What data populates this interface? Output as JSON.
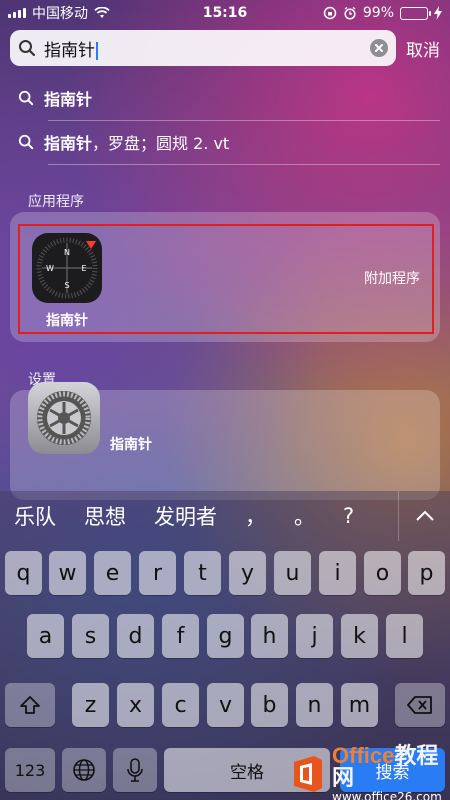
{
  "status_bar": {
    "carrier": "中国移动",
    "time": "15:16",
    "battery": "99%"
  },
  "search": {
    "value": "指南针",
    "cancel_label": "取消"
  },
  "suggestions": [
    {
      "bold": "指南针",
      "rest": ""
    },
    {
      "bold": "指南针",
      "rest": "，罗盘；圆规 2. vt"
    }
  ],
  "sections": {
    "apps_label": "应用程序",
    "settings_label": "设置"
  },
  "app_result": {
    "name": "指南针",
    "extra_label": "附加程序",
    "compass_letters": {
      "n": "N",
      "e": "E",
      "s": "S",
      "w": "W"
    }
  },
  "settings_result": {
    "name": "指南针"
  },
  "keyboard": {
    "candidates": [
      "乐队",
      "思想",
      "发明者",
      "，",
      "。",
      "?"
    ],
    "row1": [
      "q",
      "w",
      "e",
      "r",
      "t",
      "y",
      "u",
      "i",
      "o",
      "p"
    ],
    "row2": [
      "a",
      "s",
      "d",
      "f",
      "g",
      "h",
      "j",
      "k",
      "l"
    ],
    "row3": [
      "z",
      "x",
      "c",
      "v",
      "b",
      "n",
      "m"
    ],
    "numbers_label": "123",
    "space_label": "空格",
    "search_label": "搜索"
  },
  "watermark": {
    "title_a": "Office",
    "title_b": "教程网",
    "url": "www.office26.com"
  },
  "colors": {
    "battery_green": "#4cd964",
    "highlight_red": "#e02020",
    "search_blue": "#2a7cf5"
  }
}
